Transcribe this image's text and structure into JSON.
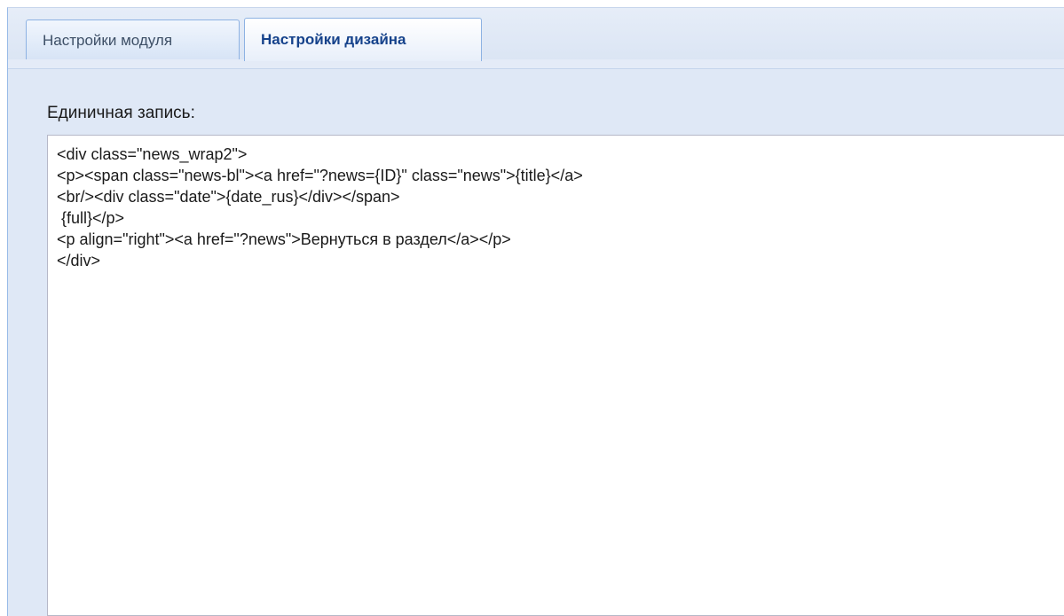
{
  "tabs": [
    {
      "label": "Настройки модуля",
      "active": false
    },
    {
      "label": "Настройки дизайна",
      "active": true
    }
  ],
  "form": {
    "field_label": "Единичная запись:",
    "template_value": "<div class=\"news_wrap2\">\n<p><span class=\"news-bl\"><a href=\"?news={ID}\" class=\"news\">{title}</a>\n<br/><div class=\"date\">{date_rus}</div></span>\n {full}</p>\n<p align=\"right\"><a href=\"?news\">Вернуться в раздел</a></p>\n</div>"
  },
  "colors": {
    "tab_active_text": "#15428b",
    "tab_border": "#99bbe8",
    "panel_background": "#dfe8f6"
  }
}
